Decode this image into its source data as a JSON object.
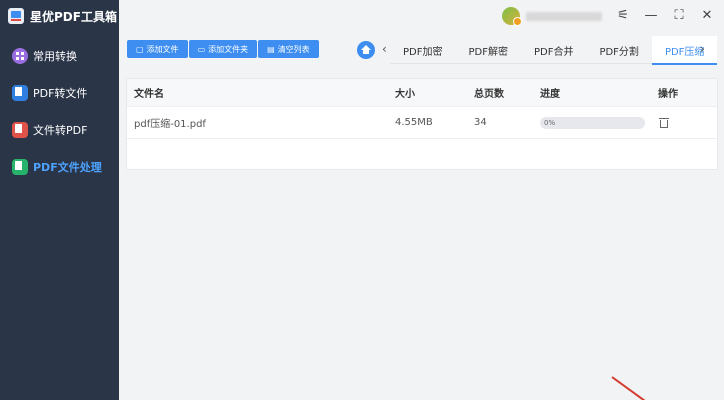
{
  "app": {
    "title": "星优PDF工具箱"
  },
  "sidebar": {
    "items": [
      {
        "label": "常用转换",
        "icon": "grid-icon"
      },
      {
        "label": "PDF转文件",
        "icon": "pdf-to-file-icon"
      },
      {
        "label": "文件转PDF",
        "icon": "file-to-pdf-icon"
      },
      {
        "label": "PDF文件处理",
        "icon": "pdf-process-icon",
        "active": true
      }
    ]
  },
  "toolbar": {
    "add_file": "添加文件",
    "add_folder": "添加文件夹",
    "clear_list": "清空列表"
  },
  "tabs": [
    {
      "label": "PDF加密"
    },
    {
      "label": "PDF解密"
    },
    {
      "label": "PDF合并"
    },
    {
      "label": "PDF分割"
    },
    {
      "label": "PDF压缩",
      "active": true
    }
  ],
  "table": {
    "headers": {
      "name": "文件名",
      "size": "大小",
      "pages": "总页数",
      "progress": "进度",
      "actions": "操作"
    },
    "rows": [
      {
        "name": "pdf压缩-01.pdf",
        "size": "4.55MB",
        "pages": "34",
        "progress": "0%",
        "progress_value": 0
      }
    ]
  },
  "colors": {
    "accent": "#3d8ef0",
    "sidebar_bg": "#2b3548"
  }
}
